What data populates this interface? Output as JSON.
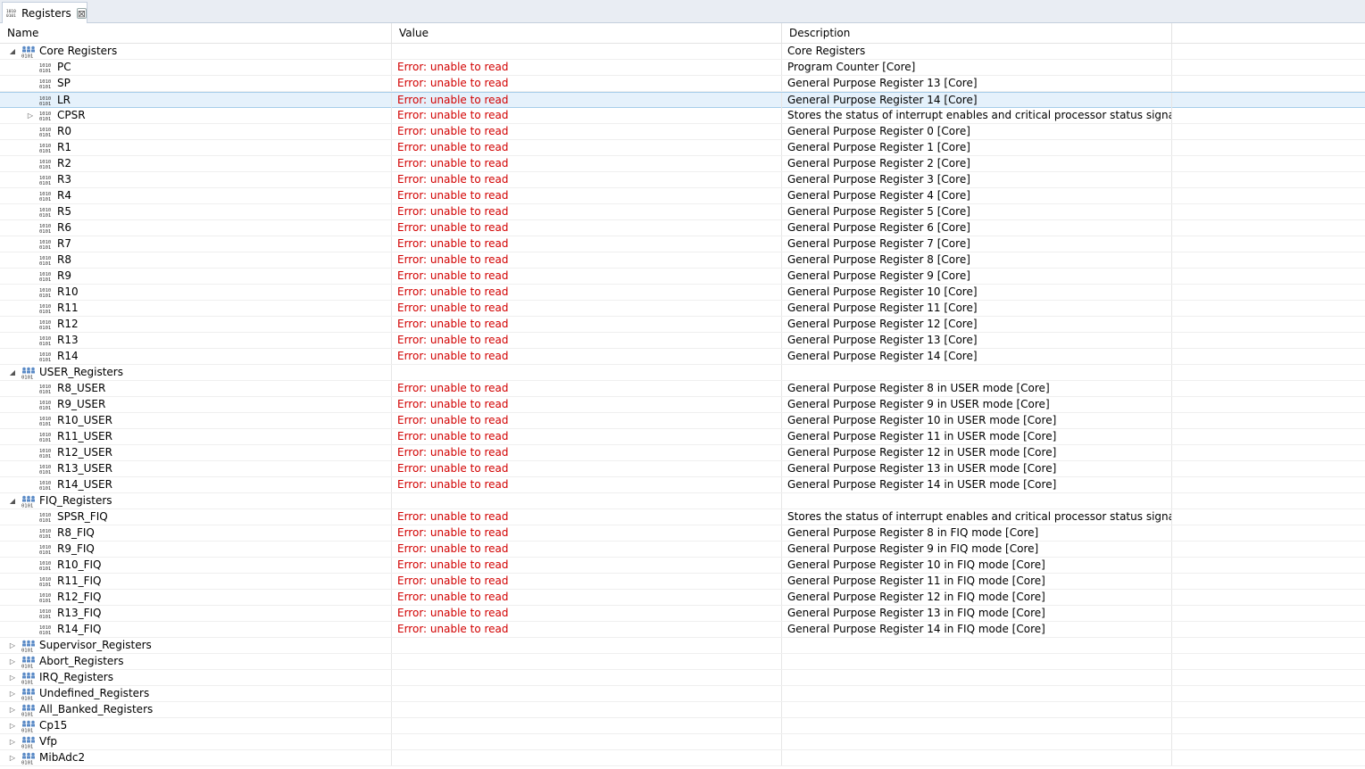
{
  "tab": {
    "title": "Registers",
    "close": "⊠"
  },
  "columns": {
    "name": "Name",
    "value": "Value",
    "description": "Description"
  },
  "rows": [
    {
      "level": 0,
      "type": "group",
      "expanded": true,
      "name": "Core Registers",
      "value": "",
      "desc": "Core Registers"
    },
    {
      "level": 1,
      "type": "reg",
      "name": "PC",
      "value": "Error: unable to read",
      "desc": "Program Counter [Core]"
    },
    {
      "level": 1,
      "type": "reg",
      "name": "SP",
      "value": "Error: unable to read",
      "desc": "General Purpose Register 13 [Core]"
    },
    {
      "level": 1,
      "type": "reg",
      "name": "LR",
      "value": "Error: unable to read",
      "desc": "General Purpose Register 14 [Core]",
      "selected": true
    },
    {
      "level": 1,
      "type": "reg",
      "name": "CPSR",
      "value": "Error: unable to read",
      "desc": "Stores the status of interrupt enables and critical processor status signa...",
      "expandable": true
    },
    {
      "level": 1,
      "type": "reg",
      "name": "R0",
      "value": "Error: unable to read",
      "desc": "General Purpose Register 0 [Core]"
    },
    {
      "level": 1,
      "type": "reg",
      "name": "R1",
      "value": "Error: unable to read",
      "desc": "General Purpose Register 1 [Core]"
    },
    {
      "level": 1,
      "type": "reg",
      "name": "R2",
      "value": "Error: unable to read",
      "desc": "General Purpose Register 2 [Core]"
    },
    {
      "level": 1,
      "type": "reg",
      "name": "R3",
      "value": "Error: unable to read",
      "desc": "General Purpose Register 3 [Core]"
    },
    {
      "level": 1,
      "type": "reg",
      "name": "R4",
      "value": "Error: unable to read",
      "desc": "General Purpose Register 4 [Core]"
    },
    {
      "level": 1,
      "type": "reg",
      "name": "R5",
      "value": "Error: unable to read",
      "desc": "General Purpose Register 5 [Core]"
    },
    {
      "level": 1,
      "type": "reg",
      "name": "R6",
      "value": "Error: unable to read",
      "desc": "General Purpose Register 6 [Core]"
    },
    {
      "level": 1,
      "type": "reg",
      "name": "R7",
      "value": "Error: unable to read",
      "desc": "General Purpose Register 7 [Core]"
    },
    {
      "level": 1,
      "type": "reg",
      "name": "R8",
      "value": "Error: unable to read",
      "desc": "General Purpose Register 8 [Core]"
    },
    {
      "level": 1,
      "type": "reg",
      "name": "R9",
      "value": "Error: unable to read",
      "desc": "General Purpose Register 9 [Core]"
    },
    {
      "level": 1,
      "type": "reg",
      "name": "R10",
      "value": "Error: unable to read",
      "desc": "General Purpose Register 10 [Core]"
    },
    {
      "level": 1,
      "type": "reg",
      "name": "R11",
      "value": "Error: unable to read",
      "desc": "General Purpose Register 11 [Core]"
    },
    {
      "level": 1,
      "type": "reg",
      "name": "R12",
      "value": "Error: unable to read",
      "desc": "General Purpose Register 12 [Core]"
    },
    {
      "level": 1,
      "type": "reg",
      "name": "R13",
      "value": "Error: unable to read",
      "desc": "General Purpose Register 13 [Core]"
    },
    {
      "level": 1,
      "type": "reg",
      "name": "R14",
      "value": "Error: unable to read",
      "desc": "General Purpose Register 14 [Core]"
    },
    {
      "level": 0,
      "type": "group",
      "expanded": true,
      "name": "USER_Registers",
      "value": "",
      "desc": ""
    },
    {
      "level": 1,
      "type": "reg",
      "name": "R8_USER",
      "value": "Error: unable to read",
      "desc": "General Purpose Register 8 in USER mode [Core]"
    },
    {
      "level": 1,
      "type": "reg",
      "name": "R9_USER",
      "value": "Error: unable to read",
      "desc": "General Purpose Register 9 in USER mode [Core]"
    },
    {
      "level": 1,
      "type": "reg",
      "name": "R10_USER",
      "value": "Error: unable to read",
      "desc": "General Purpose Register 10 in USER mode [Core]"
    },
    {
      "level": 1,
      "type": "reg",
      "name": "R11_USER",
      "value": "Error: unable to read",
      "desc": "General Purpose Register 11 in USER mode [Core]"
    },
    {
      "level": 1,
      "type": "reg",
      "name": "R12_USER",
      "value": "Error: unable to read",
      "desc": "General Purpose Register 12 in USER mode [Core]"
    },
    {
      "level": 1,
      "type": "reg",
      "name": "R13_USER",
      "value": "Error: unable to read",
      "desc": "General Purpose Register 13 in USER mode [Core]"
    },
    {
      "level": 1,
      "type": "reg",
      "name": "R14_USER",
      "value": "Error: unable to read",
      "desc": "General Purpose Register 14 in USER mode [Core]"
    },
    {
      "level": 0,
      "type": "group",
      "expanded": true,
      "name": "FIQ_Registers",
      "value": "",
      "desc": ""
    },
    {
      "level": 1,
      "type": "reg",
      "name": "SPSR_FIQ",
      "value": "Error: unable to read",
      "desc": "Stores the status of interrupt enables and critical processor status signa..."
    },
    {
      "level": 1,
      "type": "reg",
      "name": "R8_FIQ",
      "value": "Error: unable to read",
      "desc": "General Purpose Register 8 in FIQ mode [Core]"
    },
    {
      "level": 1,
      "type": "reg",
      "name": "R9_FIQ",
      "value": "Error: unable to read",
      "desc": "General Purpose Register 9 in FIQ mode [Core]"
    },
    {
      "level": 1,
      "type": "reg",
      "name": "R10_FIQ",
      "value": "Error: unable to read",
      "desc": "General Purpose Register 10 in FIQ mode [Core]"
    },
    {
      "level": 1,
      "type": "reg",
      "name": "R11_FIQ",
      "value": "Error: unable to read",
      "desc": "General Purpose Register 11 in FIQ mode [Core]"
    },
    {
      "level": 1,
      "type": "reg",
      "name": "R12_FIQ",
      "value": "Error: unable to read",
      "desc": "General Purpose Register 12 in FIQ mode [Core]"
    },
    {
      "level": 1,
      "type": "reg",
      "name": "R13_FIQ",
      "value": "Error: unable to read",
      "desc": "General Purpose Register 13 in FIQ mode [Core]"
    },
    {
      "level": 1,
      "type": "reg",
      "name": "R14_FIQ",
      "value": "Error: unable to read",
      "desc": "General Purpose Register 14 in FIQ mode [Core]"
    },
    {
      "level": 0,
      "type": "group",
      "expanded": false,
      "name": "Supervisor_Registers",
      "value": "",
      "desc": ""
    },
    {
      "level": 0,
      "type": "group",
      "expanded": false,
      "name": "Abort_Registers",
      "value": "",
      "desc": ""
    },
    {
      "level": 0,
      "type": "group",
      "expanded": false,
      "name": "IRQ_Registers",
      "value": "",
      "desc": ""
    },
    {
      "level": 0,
      "type": "group",
      "expanded": false,
      "name": "Undefined_Registers",
      "value": "",
      "desc": ""
    },
    {
      "level": 0,
      "type": "group",
      "expanded": false,
      "name": "All_Banked_Registers",
      "value": "",
      "desc": ""
    },
    {
      "level": 0,
      "type": "group",
      "expanded": false,
      "name": "Cp15",
      "value": "",
      "desc": ""
    },
    {
      "level": 0,
      "type": "group",
      "expanded": false,
      "name": "Vfp",
      "value": "",
      "desc": ""
    },
    {
      "level": 0,
      "type": "group",
      "expanded": false,
      "name": "MibAdc2",
      "value": "",
      "desc": ""
    }
  ]
}
